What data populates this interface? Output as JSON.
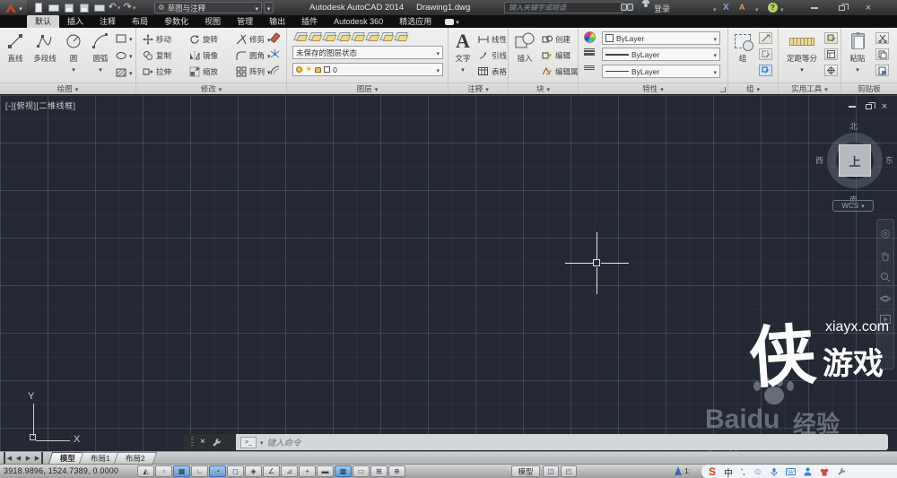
{
  "titlebar": {
    "workspace_label": "草图与注释",
    "app_title": "Autodesk AutoCAD 2014",
    "doc_title": "Drawing1.dwg",
    "search_placeholder": "键入关键字或短语",
    "signin_label": "登录"
  },
  "ribbon_tabs": [
    {
      "label": "默认",
      "active": true
    },
    {
      "label": "插入"
    },
    {
      "label": "注释"
    },
    {
      "label": "布局"
    },
    {
      "label": "参数化"
    },
    {
      "label": "视图"
    },
    {
      "label": "管理"
    },
    {
      "label": "输出"
    },
    {
      "label": "插件"
    },
    {
      "label": "Autodesk 360"
    },
    {
      "label": "精选应用"
    }
  ],
  "panels": {
    "draw": {
      "title": "绘图",
      "tools": [
        "直线",
        "多段线",
        "圆",
        "圆弧"
      ]
    },
    "modify": {
      "title": "修改",
      "grid": [
        [
          "移动",
          "旋转",
          "修剪"
        ],
        [
          "复制",
          "镜像",
          "圆角"
        ],
        [
          "拉伸",
          "缩放",
          "阵列"
        ]
      ]
    },
    "layers": {
      "title": "图层",
      "state": "未保存的图层状态",
      "current": "0",
      "tools": [
        "layer-properties",
        "layer-match",
        "layer-prev",
        "layer-isolate",
        "layer-unisolate",
        "layer-freeze",
        "layer-off",
        "layer-lock"
      ]
    },
    "annotation": {
      "title": "注释",
      "big": "文字",
      "items": [
        "线性",
        "引线",
        "表格"
      ]
    },
    "block": {
      "title": "块",
      "big": "插入",
      "items": [
        "创建",
        "编辑",
        "编辑属性"
      ]
    },
    "properties": {
      "title": "特性",
      "color": "ByLayer",
      "lineweight": "ByLayer",
      "linetype": "ByLayer"
    },
    "group": {
      "title": "组",
      "big": "组"
    },
    "utilities": {
      "title": "实用工具",
      "big": "定距等分"
    },
    "clipboard": {
      "title": "剪贴板",
      "big": "粘贴"
    }
  },
  "canvas": {
    "viewport_label": "[-][俯视][二维线框]",
    "viewcube": {
      "north": "北",
      "south": "南",
      "west": "西",
      "east": "东",
      "top": "上",
      "wcs": "WCS"
    },
    "ucs": {
      "x": "X",
      "y": "Y"
    },
    "command_prompt": ">_",
    "command_placeholder": "键入命令"
  },
  "layout_bar": {
    "tabs": [
      {
        "label": "模型",
        "active": true
      },
      {
        "label": "布局1",
        "active": false
      },
      {
        "label": "布局2",
        "active": false
      }
    ]
  },
  "statusbar": {
    "coordinates": "3918.9896, 1524.7389, 0.0000",
    "model_button": "模型",
    "annotation_scale": "1:",
    "toggles": [
      {
        "name": "infer-constraints",
        "glyph": "◭",
        "active": false
      },
      {
        "name": "snap-mode",
        "glyph": "▫",
        "active": false
      },
      {
        "name": "grid-display",
        "glyph": "▦",
        "active": true
      },
      {
        "name": "ortho-mode",
        "glyph": "∟",
        "active": false
      },
      {
        "name": "polar-tracking",
        "glyph": "◔",
        "active": true
      },
      {
        "name": "object-snap",
        "glyph": "◻",
        "active": false
      },
      {
        "name": "3d-object-snap",
        "glyph": "◈",
        "active": false
      },
      {
        "name": "object-snap-tracking",
        "glyph": "∠",
        "active": false
      },
      {
        "name": "dynamic-ucs",
        "glyph": "⊿",
        "active": false
      },
      {
        "name": "dynamic-input",
        "glyph": "+",
        "active": false
      },
      {
        "name": "lineweight",
        "glyph": "▬",
        "active": false
      },
      {
        "name": "transparency",
        "glyph": "▩",
        "active": true
      },
      {
        "name": "quick-properties",
        "glyph": "▭",
        "active": false
      },
      {
        "name": "selection-cycling",
        "glyph": "⊞",
        "active": false
      },
      {
        "name": "annotation-monitor",
        "glyph": "⊕",
        "active": false
      }
    ],
    "ime": {
      "logo": "S",
      "lang": "中",
      "punct": "’,",
      "smiley": "☺"
    }
  },
  "watermarks": {
    "baidu_word": "Baidu",
    "baidu_exp": "经验",
    "baidu_url": "jingyan.baidu.com",
    "xiayx_big": "侠",
    "xiayx_small": "游戏",
    "xiayx_url": "xiayx.com"
  },
  "icons": {
    "chevron-down": "▾",
    "gear": "⚙",
    "undo": "↶",
    "redo": "↷"
  },
  "colors": {
    "accent_blue": "#5b9bd5",
    "canvas_bg": "#232832",
    "sogou_red": "#e03a1e",
    "logo_red": "#c8402a"
  }
}
